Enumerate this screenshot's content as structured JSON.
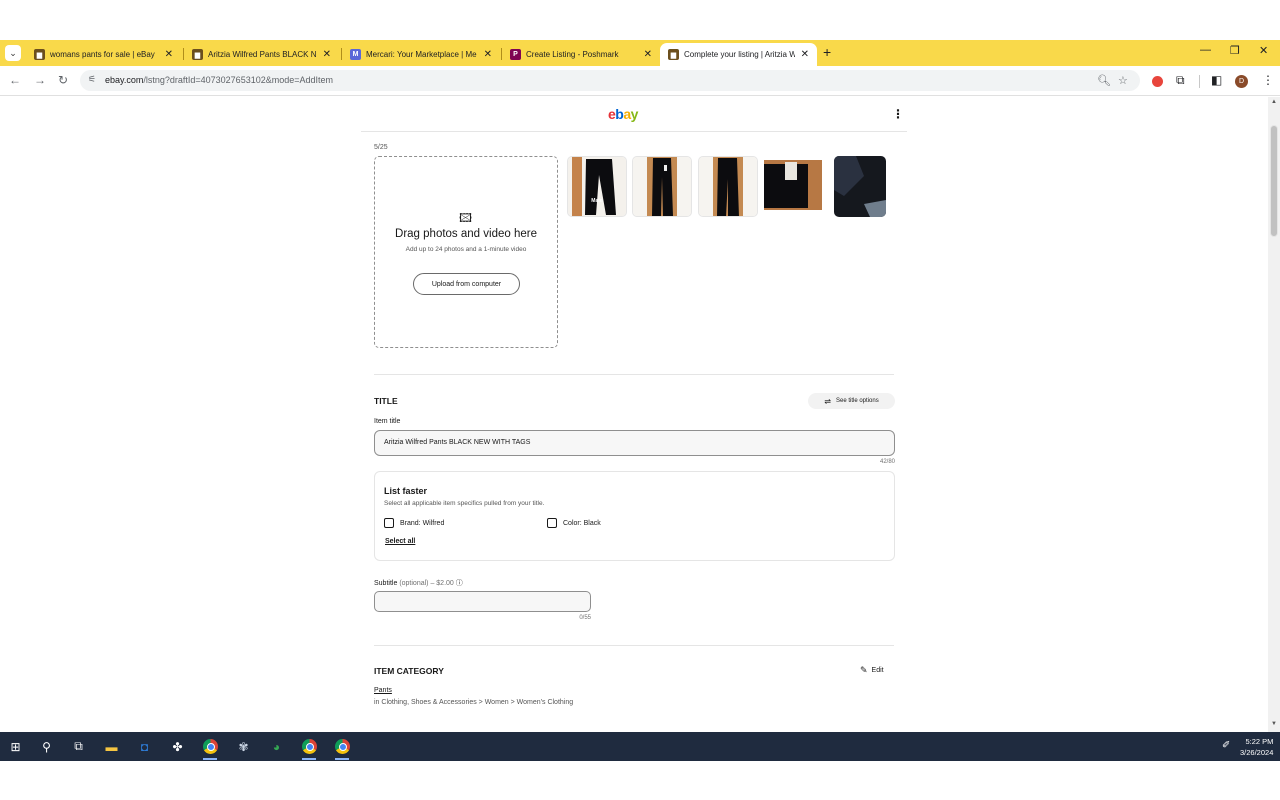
{
  "browser": {
    "tabs": [
      {
        "title": "womans pants for sale | eBay",
        "favicon": "ebay-bag-icon",
        "active": false
      },
      {
        "title": "Aritzia Wilfred Pants BLACK NE",
        "favicon": "ebay-bag-icon",
        "active": false
      },
      {
        "title": "Mercari: Your Marketplace | Me",
        "favicon": "mercari-icon",
        "active": false
      },
      {
        "title": "Create Listing - Poshmark",
        "favicon": "poshmark-icon",
        "active": false
      },
      {
        "title": "Complete your listing | Aritzia W",
        "favicon": "ebay-bag-icon",
        "active": true
      }
    ],
    "url_host": "ebay.com",
    "url_path": "/lstng?draftId=4073027653102&mode=AddItem",
    "avatar_letter": "D"
  },
  "header": {
    "logo": {
      "e": "e",
      "b": "b",
      "a": "a",
      "y": "y"
    },
    "menu_icon": "⋮"
  },
  "photos": {
    "count": "5/25",
    "drop_headline": "Drag photos and video here",
    "drop_sub": "Add up to 24 photos and a 1-minute video",
    "upload_button": "Upload from computer",
    "thumbnails": [
      {
        "name": "photo-1",
        "badge": "Main"
      },
      {
        "name": "photo-2",
        "badge": ""
      },
      {
        "name": "photo-3",
        "badge": ""
      },
      {
        "name": "photo-4",
        "badge": ""
      },
      {
        "name": "photo-5",
        "badge": ""
      }
    ]
  },
  "title_section": {
    "heading": "TITLE",
    "options_button": "See title options",
    "item_title_label": "Item title",
    "item_title_value": "Aritzia Wilfred Pants BLACK  NEW WITH TAGS",
    "title_counter": "42/80",
    "list_faster": {
      "heading": "List faster",
      "description": "Select all applicable item specifics pulled from your title.",
      "options": [
        "Brand: Wilfred",
        "Color: Black"
      ],
      "select_all": "Select all"
    },
    "subtitle_label": "Subtitle",
    "subtitle_note": "(optional) – $2.00",
    "subtitle_counter": "0/55"
  },
  "category_section": {
    "heading": "ITEM CATEGORY",
    "edit_button": "Edit",
    "category": "Pants",
    "path": "in Clothing, Shoes & Accessories > Women > Women's Clothing"
  },
  "taskbar": {
    "time": "5:22 PM",
    "date": "3/26/2024"
  }
}
